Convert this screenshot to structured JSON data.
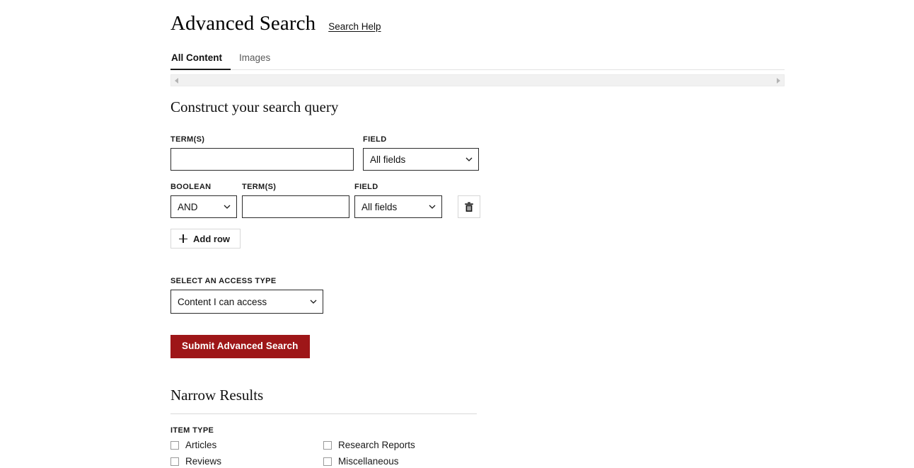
{
  "header": {
    "title": "Advanced Search",
    "help_link": "Search Help"
  },
  "tabs": [
    {
      "label": "All Content",
      "active": true
    },
    {
      "label": "Images",
      "active": false
    }
  ],
  "scrollbar": {
    "left_arrow": "triangle-left-icon",
    "right_arrow": "triangle-right-icon"
  },
  "query_section": {
    "heading": "Construct your search query",
    "row1": {
      "terms_label": "TERM(S)",
      "terms_value": "",
      "terms_placeholder": "",
      "field_label": "FIELD",
      "field_value": "All fields"
    },
    "row2": {
      "boolean_label": "BOOLEAN",
      "boolean_value": "AND",
      "terms_label": "TERM(S)",
      "terms_value": "",
      "terms_placeholder": "",
      "field_label": "FIELD",
      "field_value": "All fields",
      "delete_icon": "trash-icon"
    },
    "add_row_label": "Add row",
    "add_row_icon": "plus-icon"
  },
  "access": {
    "label": "SELECT AN ACCESS TYPE",
    "value": "Content I can access"
  },
  "submit": {
    "label": "Submit Advanced Search",
    "color": "#9e1618"
  },
  "narrow_results": {
    "heading": "Narrow Results",
    "item_type_label": "ITEM TYPE",
    "checkboxes": [
      {
        "label": "Articles",
        "checked": false
      },
      {
        "label": "Research Reports",
        "checked": false
      },
      {
        "label": "Reviews",
        "checked": false
      },
      {
        "label": "Miscellaneous",
        "checked": false
      }
    ]
  }
}
